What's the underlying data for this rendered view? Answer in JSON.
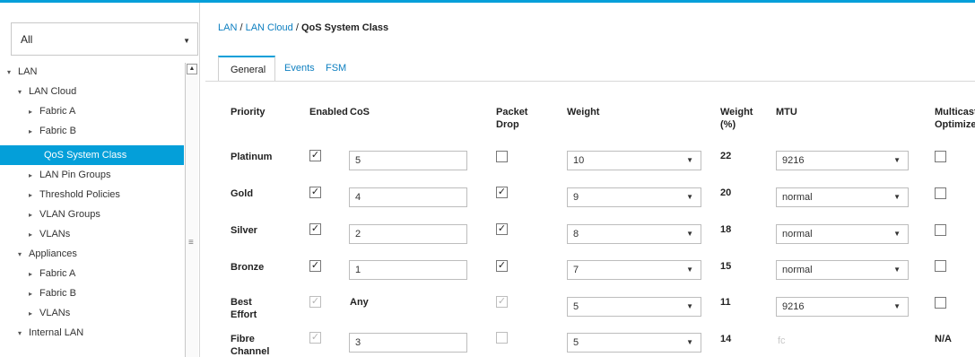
{
  "filter": {
    "value": "All"
  },
  "tree": [
    {
      "label": "LAN",
      "arrow": "▾"
    },
    {
      "label": "LAN Cloud",
      "arrow": "▾"
    },
    {
      "label": "Fabric A",
      "arrow": "▸"
    },
    {
      "label": "Fabric B",
      "arrow": "▸"
    },
    {
      "label": "QoS System Class",
      "arrow": ""
    },
    {
      "label": "LAN Pin Groups",
      "arrow": "▸"
    },
    {
      "label": "Threshold Policies",
      "arrow": "▸"
    },
    {
      "label": "VLAN Groups",
      "arrow": "▸"
    },
    {
      "label": "VLANs",
      "arrow": "▸"
    },
    {
      "label": "Appliances",
      "arrow": "▾"
    },
    {
      "label": "Fabric A",
      "arrow": "▸"
    },
    {
      "label": "Fabric B",
      "arrow": "▸"
    },
    {
      "label": "VLANs",
      "arrow": "▸"
    },
    {
      "label": "Internal LAN",
      "arrow": "▾"
    }
  ],
  "breadcrumb": {
    "part1": "LAN",
    "sep1": " / ",
    "part2": "LAN Cloud",
    "sep2": " / ",
    "part3": "QoS System Class"
  },
  "tabs": [
    "General",
    "Events",
    "FSM"
  ],
  "headers": {
    "priority": "Priority",
    "enabled": "Enabled",
    "cos": "CoS",
    "packet_drop_1": "Packet",
    "packet_drop_2": "Drop",
    "weight": "Weight",
    "weight_pct_1": "Weight",
    "weight_pct_2": "(%)",
    "mtu": "MTU",
    "multicast_1": "Multicast",
    "multicast_2": "Optimize"
  },
  "rows": [
    {
      "priority": "Platinum",
      "priority2": "",
      "enabled": true,
      "enabled_disabled": false,
      "cos": "5",
      "cos_editable": true,
      "packet_drop": false,
      "packet_drop_disabled": false,
      "weight": "10",
      "weight_pct": "22",
      "mtu": "9216",
      "mtu_editable": true,
      "multicast": false,
      "multicast_text": ""
    },
    {
      "priority": "Gold",
      "priority2": "",
      "enabled": true,
      "enabled_disabled": false,
      "cos": "4",
      "cos_editable": true,
      "packet_drop": true,
      "packet_drop_disabled": false,
      "weight": "9",
      "weight_pct": "20",
      "mtu": "normal",
      "mtu_editable": true,
      "multicast": false,
      "multicast_text": ""
    },
    {
      "priority": "Silver",
      "priority2": "",
      "enabled": true,
      "enabled_disabled": false,
      "cos": "2",
      "cos_editable": true,
      "packet_drop": true,
      "packet_drop_disabled": false,
      "weight": "8",
      "weight_pct": "18",
      "mtu": "normal",
      "mtu_editable": true,
      "multicast": false,
      "multicast_text": ""
    },
    {
      "priority": "Bronze",
      "priority2": "",
      "enabled": true,
      "enabled_disabled": false,
      "cos": "1",
      "cos_editable": true,
      "packet_drop": true,
      "packet_drop_disabled": false,
      "weight": "7",
      "weight_pct": "15",
      "mtu": "normal",
      "mtu_editable": true,
      "multicast": false,
      "multicast_text": ""
    },
    {
      "priority": "Best",
      "priority2": "Effort",
      "enabled": true,
      "enabled_disabled": true,
      "cos": "Any",
      "cos_editable": false,
      "packet_drop": true,
      "packet_drop_disabled": true,
      "weight": "5",
      "weight_pct": "11",
      "mtu": "9216",
      "mtu_editable": true,
      "multicast": false,
      "multicast_text": ""
    },
    {
      "priority": "Fibre",
      "priority2": "Channel",
      "enabled": true,
      "enabled_disabled": true,
      "cos": "3",
      "cos_editable": true,
      "packet_drop": false,
      "packet_drop_disabled": true,
      "weight": "5",
      "weight_pct": "14",
      "mtu": "fc",
      "mtu_editable": false,
      "multicast": false,
      "multicast_text": "N/A"
    }
  ],
  "colors": {
    "accent": "#049fd9",
    "link": "#0d7fc0"
  }
}
